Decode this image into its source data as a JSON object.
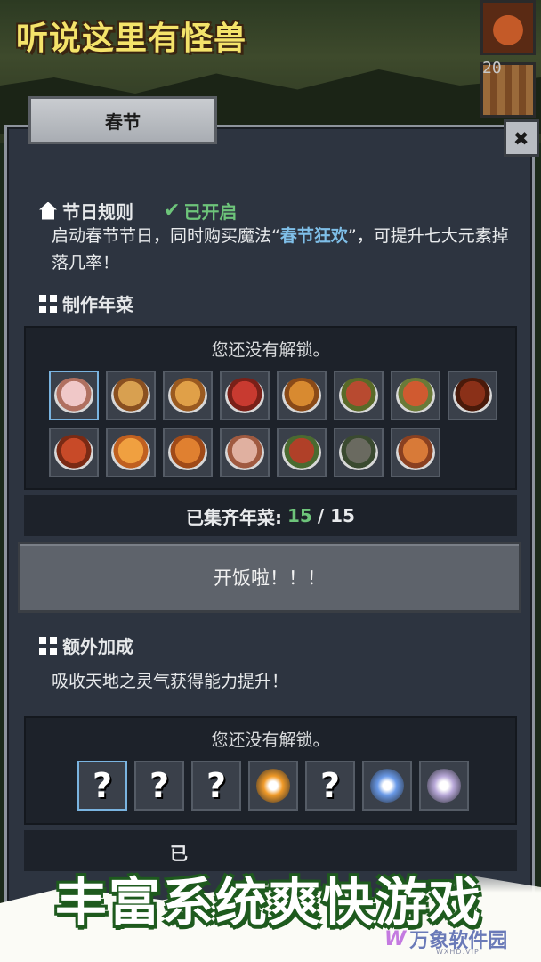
{
  "game": {
    "title": "听说这里有怪兽",
    "corner_count": "20"
  },
  "panel": {
    "tab_title": "春节",
    "close_label": "✖"
  },
  "festival_rules": {
    "heading": "节日规则",
    "status": "已开启",
    "desc_prefix": "启动春节节日，同时购买魔法“",
    "desc_highlight": "春节狂欢",
    "desc_suffix": "”，可提升七大元素掉落几率！"
  },
  "new_year_dishes": {
    "heading": "制作年菜",
    "locked_text": "您还没有解锁。",
    "dishes": [
      {
        "c1": "#f0c8c8",
        "c2": "#b07060"
      },
      {
        "c1": "#d8a050",
        "c2": "#8a5020"
      },
      {
        "c1": "#e0a048",
        "c2": "#9a5a20"
      },
      {
        "c1": "#c83a30",
        "c2": "#7a2018"
      },
      {
        "c1": "#d88a30",
        "c2": "#8a4a18"
      },
      {
        "c1": "#b84a30",
        "c2": "#5a6a28"
      },
      {
        "c1": "#d05a30",
        "c2": "#6a7a38"
      },
      {
        "c1": "#8a3018",
        "c2": "#4a1a0a"
      },
      {
        "c1": "#c84a28",
        "c2": "#7a2a14"
      },
      {
        "c1": "#f0a040",
        "c2": "#c06020"
      },
      {
        "c1": "#e08030",
        "c2": "#a04a18"
      },
      {
        "c1": "#e0b0a0",
        "c2": "#a05a40"
      },
      {
        "c1": "#b04028",
        "c2": "#4a6a30"
      },
      {
        "c1": "#6a6a60",
        "c2": "#3a4a30"
      },
      {
        "c1": "#d87a38",
        "c2": "#8a4020"
      }
    ],
    "collected_label": "已集齐年菜:",
    "collected": "15",
    "total": "/ 15"
  },
  "eat_button": {
    "label": "开饭啦！！！"
  },
  "extra_bonus": {
    "heading": "额外加成",
    "desc": "吸收天地之灵气获得能力提升！",
    "locked_text": "您还没有解锁。",
    "slots": [
      {
        "type": "unknown",
        "label": "?"
      },
      {
        "type": "unknown",
        "label": "?"
      },
      {
        "type": "unknown",
        "label": "?"
      },
      {
        "type": "orb",
        "color": "#f09a28"
      },
      {
        "type": "unknown",
        "label": "?"
      },
      {
        "type": "orb",
        "color": "#6a9ae8"
      },
      {
        "type": "orb",
        "color": "#b8a8d8"
      }
    ],
    "bottom_partial": "已"
  },
  "promo": {
    "slogan": "丰富系统爽快游戏"
  },
  "watermark": {
    "logo": "W",
    "text": "万象软件园",
    "sub": "WXHD.VIP"
  }
}
